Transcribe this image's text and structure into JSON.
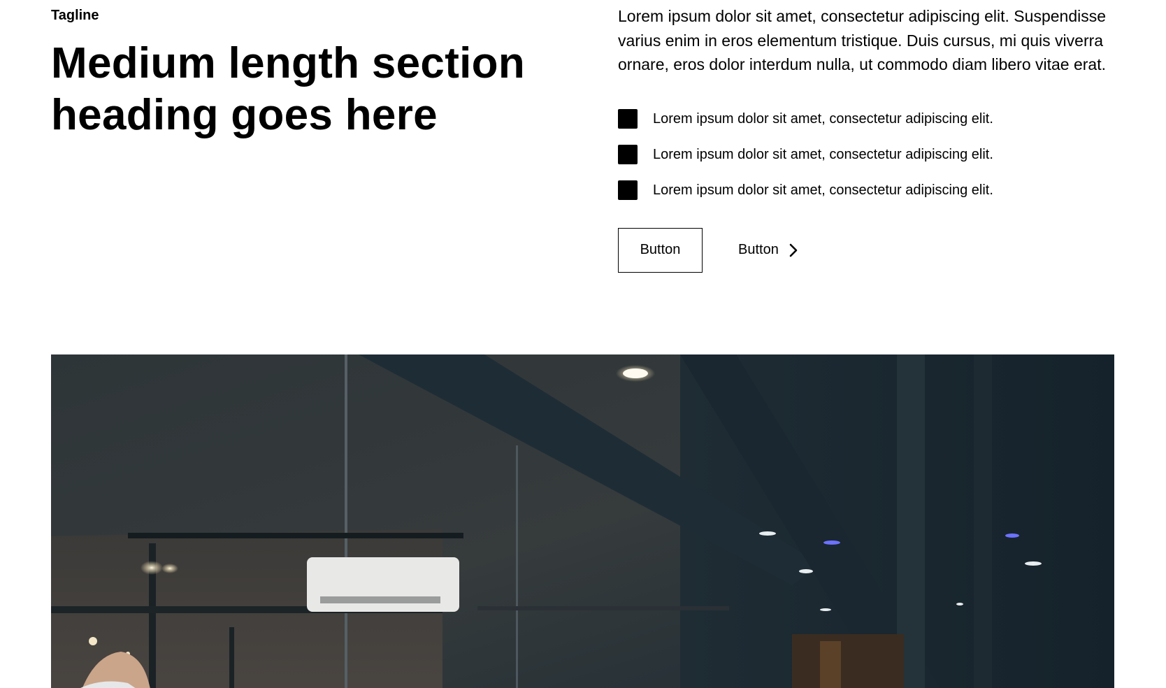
{
  "section": {
    "tagline": "Tagline",
    "heading_line1": "Medium length section",
    "heading_line2": "heading goes here",
    "intro": "Lorem ipsum dolor sit amet, consectetur adipiscing elit. Suspendisse varius enim in eros elementum tristique. Duis cursus, mi quis viverra ornare, eros dolor interdum nulla, ut commodo diam libero vitae erat.",
    "checklist": [
      {
        "text": "Lorem ipsum dolor sit amet, consectetur adipiscing elit.",
        "icon": "square-bullet-icon"
      },
      {
        "text": "Lorem ipsum dolor sit amet, consectetur adipiscing elit.",
        "icon": "square-bullet-icon"
      },
      {
        "text": "Lorem ipsum dolor sit amet, consectetur adipiscing elit.",
        "icon": "square-bullet-icon"
      }
    ],
    "primary_button_label": "Button",
    "secondary_button_label": "Button",
    "secondary_button_icon": "chevron-right-icon"
  },
  "hero_image": {
    "subject": "dark office interior with ceiling lights, air conditioner and glass partitions"
  },
  "colors": {
    "text": "#000000",
    "background": "#ffffff",
    "image_dark": "#1a2530"
  }
}
